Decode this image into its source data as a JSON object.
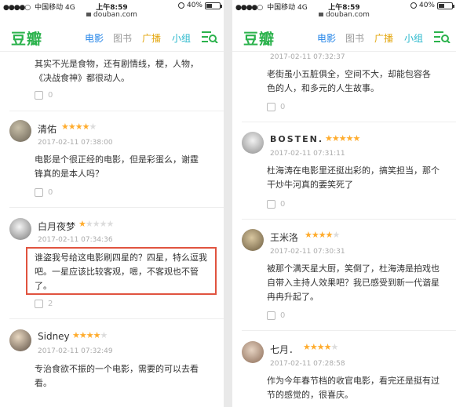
{
  "status": {
    "carrier": "中国移动",
    "network": "4G",
    "time": "上午8:59",
    "battery": "40%",
    "battery_level": 0.4
  },
  "url": "douban.com",
  "nav": {
    "logo": "豆瓣",
    "links": [
      "电影",
      "图书",
      "广播",
      "小组"
    ]
  },
  "left": {
    "top_text": "其实不光是食物，还有剧情线，梗，人物，《决战食神》都很动人。",
    "top_votes": "0",
    "comments": [
      {
        "name": "清佑",
        "rating": 4,
        "time": "2017-02-11 07:38:00",
        "text": "电影是个很正经的电影，但是彩蛋么，谢霆锋真的是本人吗？",
        "votes": "0"
      },
      {
        "name": "白月夜梦",
        "rating": 1,
        "time": "2017-02-11 07:34:36",
        "text": "谁盗我号给这电影刷四星的？四星，特么逗我吧。一星应该比较客观，嗯，不客观也不管了。",
        "votes": "2"
      },
      {
        "name": "Sidney",
        "rating": 4,
        "time": "2017-02-11 07:32:49",
        "text": "专治食欲不振的一个电影，需要的可以去看看。",
        "votes": ""
      }
    ]
  },
  "right": {
    "top_time": "2017-02-11 07:32:37",
    "top_text": "老街虽小五脏俱全，空间不大，却能包容各色的人，和多元的人生故事。",
    "top_votes": "0",
    "comments": [
      {
        "name": "BOSTEN.",
        "rating": 5,
        "time": "2017-02-11 07:31:11",
        "text": "杜海涛在电影里还挺出彩的，搞笑担当，那个干炒牛河真的要笑死了",
        "votes": "0"
      },
      {
        "name": "王米洛",
        "rating": 4,
        "time": "2017-02-11 07:30:31",
        "text": "被那个满天星大厨，笑倒了，杜海涛是拍戏也自带入主持人效果吧？我已感受到新一代谐星冉冉升起了。",
        "votes": "0"
      },
      {
        "name": "七月．",
        "rating": 4,
        "time": "2017-02-11 07:28:58",
        "text": "作为今年春节档的收官电影，看完还是挺有过节的感觉的，很喜庆。",
        "votes": ""
      }
    ]
  }
}
